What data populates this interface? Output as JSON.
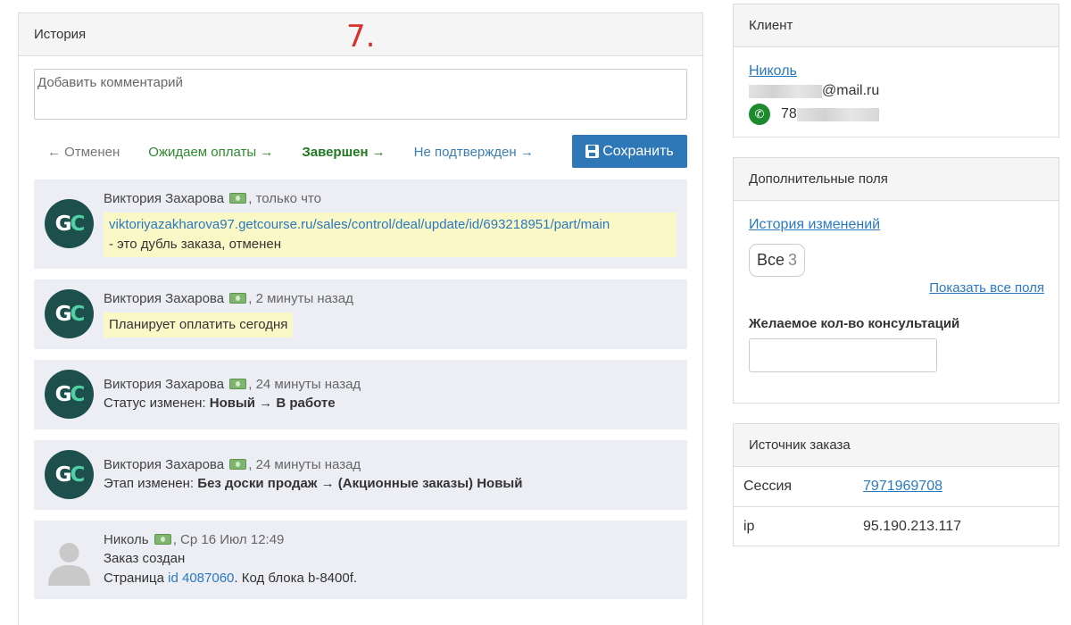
{
  "history": {
    "title": "История",
    "marker": "7.",
    "comment_placeholder": "Добавить комментарий",
    "actions": {
      "cancel": "← Отменен",
      "waiting": "Ожидаем оплаты →",
      "completed": "Завершен →",
      "not_confirmed": "Не подтвержден →",
      "save": "Сохранить"
    },
    "entries": [
      {
        "author": "Виктория Захарова",
        "time": ", только что",
        "link": "viktoriyazakharova97.getcourse.ru/sales/control/deal/update/id/693218951/part/main",
        "text": "- это дубль заказа, отменен"
      },
      {
        "author": "Виктория Захарова",
        "time": ", 2 минуты назад",
        "text": "Планирует оплатить сегодня"
      },
      {
        "author": "Виктория Захарова",
        "time": ", 24 минуты назад",
        "prefix": "Статус изменен: ",
        "bold": "Новый → В работе"
      },
      {
        "author": "Виктория Захарова",
        "time": ", 24 минуты назад",
        "prefix": "Этап изменен: ",
        "bold": "Без доски продаж → (Акционные заказы) Новый"
      },
      {
        "author": "Николь",
        "time": ", Ср 16 Июл 12:49",
        "line1": "Заказ создан",
        "line2_prefix": "Страница ",
        "line2_link": "id 4087060",
        "line2_suffix": ". Код блока b-8400f."
      }
    ],
    "avatar_letters": {
      "g": "G",
      "c": "C"
    }
  },
  "client": {
    "title": "Клиент",
    "name": "Николь",
    "email_suffix": "@mail.ru",
    "phone_prefix": "78",
    "phone_icon": "phone-icon"
  },
  "extra_fields": {
    "title": "Дополнительные поля",
    "history_link": "История изменений",
    "all_label": "Все",
    "all_count": "3",
    "show_all": "Показать все поля",
    "field_label": "Желаемое кол-во консультаций",
    "field_value": ""
  },
  "source": {
    "title": "Источник заказа",
    "rows": [
      {
        "key": "Сессия",
        "value": "7971969708"
      },
      {
        "key": "ip",
        "value": "95.190.213.117"
      }
    ]
  },
  "colors": {
    "accent": "#2f78b8",
    "link": "#2a79c0",
    "success": "#1f7a1f",
    "highlight": "#fbf8c8",
    "entry_bg": "#eceef4"
  }
}
